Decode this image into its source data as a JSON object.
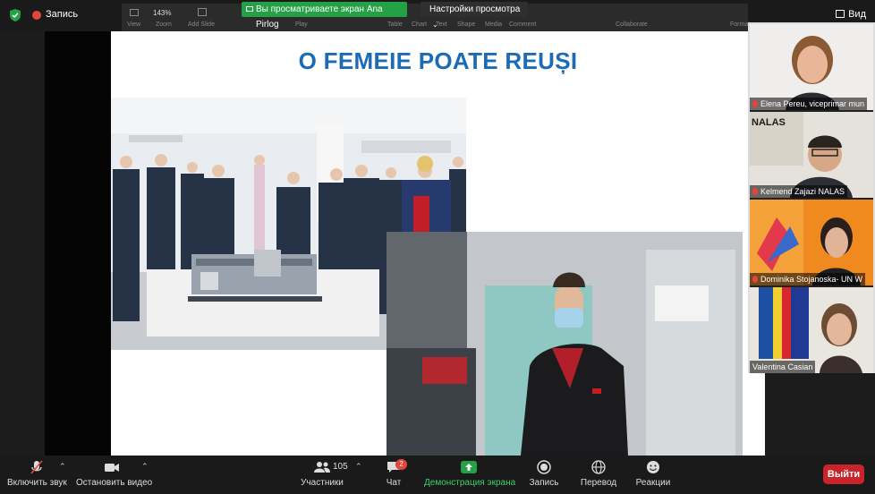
{
  "top": {
    "recording_label": "Запись",
    "view_label": "Вид",
    "share_banner": "Вы просматриваете экран Ana Pirlog",
    "view_options": "Настройки просмотра"
  },
  "ribbon": {
    "zoom_value": "143%",
    "labels": [
      "View",
      "Zoom",
      "Add Slide",
      "Play",
      "Table",
      "Chart",
      "Text",
      "Shape",
      "Media",
      "Comment",
      "Collaborate",
      "Format"
    ]
  },
  "slide": {
    "title": "O FEMEIE POATE REUȘI"
  },
  "participants": [
    {
      "name": "Elena Pereu, viceprimar mun",
      "muted": true
    },
    {
      "name": "Kelmend Zajazi NALAS",
      "muted": true,
      "backdrop_text": "NALAS"
    },
    {
      "name": "Dominika Stojanoska- UN W",
      "muted": true
    },
    {
      "name": "Valentina Casian",
      "muted": false
    }
  ],
  "toolbar": {
    "audio": "Включить звук",
    "video": "Остановить видео",
    "participants": "Участники",
    "participants_count": "105",
    "chat": "Чат",
    "chat_badge": "2",
    "share": "Демонстрация экрана",
    "record": "Запись",
    "translate": "Перевод",
    "reactions": "Реакции",
    "leave": "Выйти"
  },
  "colors": {
    "share_green": "#24a146",
    "leave_red": "#c9232c",
    "title_blue": "#1c6bb6"
  }
}
